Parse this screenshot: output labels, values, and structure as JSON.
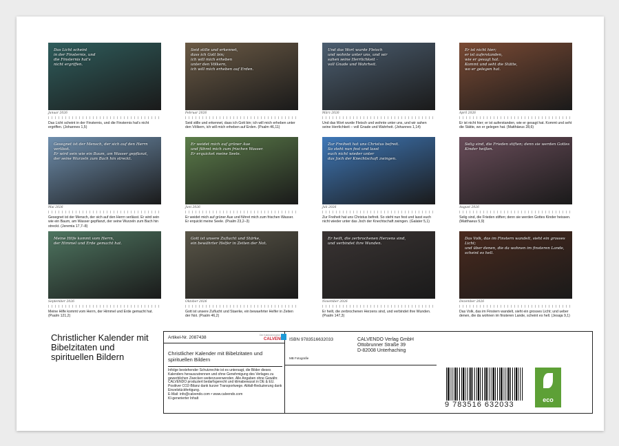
{
  "calendar": {
    "title": "Christlicher Kalender mit Bibelzitaten und spirituellen Bildern",
    "months": [
      {
        "label": "Januar 2026",
        "quote": "Das Licht scheint\nin der Finsternis, und\ndie Finsternis hat's\nnicht ergriffen.",
        "caption": "Das Licht scheint in der Finsternis, und die Finsternis hat's nicht ergriffen. (Johannes 1,5)",
        "bg": "#2f5d5c"
      },
      {
        "label": "Februar 2026",
        "quote": "Seid stille und erkennet,\ndass ich Gott bin;\nich will mich erheben\nunter den Völkern,\nich will mich erheben auf Erden.",
        "caption": "Seid stille und erkennet, dass ich Gott bin; ich will mich erheben unter den Völkern, ich will mich erheben auf Erden. (Psalm 46,11)",
        "bg": "#6b5a45"
      },
      {
        "label": "März 2026",
        "quote": "Und das Wort wurde Fleisch\nund wohnte unter uns, und wir\nsahen seine Herrlichkeit –\nvoll Gnade und Wahrheit.",
        "caption": "Und das Wort wurde Fleisch und wohnte unter uns, und wir sahen seine Herrlichkeit – voll Gnade und Wahrheit. (Johannes 1,14)",
        "bg": "#4c5e70"
      },
      {
        "label": "April 2026",
        "quote": "Er ist nicht hier;\ner ist auferstanden,\nwie er gesagt hat.\nKommt und seht die Stätte,\nwo er gelegen hat.",
        "caption": "Er ist nicht hier; er ist auferstanden, wie er gesagt hat. Kommt und seht die Stätte, wo er gelegen hat. (Matthäeus 28,6)",
        "bg": "#7a4a34"
      },
      {
        "label": "Mai 2026",
        "quote": "Gesegnet ist der Mensch, der sich auf den Herrn verlässt.\nEr wird sein wie ein Baum, am Wasser gepflanzt,\nder seine Wurzeln zum Bach hin streckt.",
        "caption": "Gesegnet ist der Mensch, der sich auf den Herrn verlässt. Er wird sein wie ein Baum, am Wasser gepflanzt, der seine Wurzeln zum Bach hin streckt. (Jeremia 17,7–8)",
        "bg": "#6f8fae"
      },
      {
        "label": "Juni 2026",
        "quote": "Er weidet mich auf grüner Aue\nund führet mich zum frischen Wasser.\nEr erquicket meine Seele.",
        "caption": "Er weidet mich auf grüner Aue und führet mich zum frischen Wasser. Er erquickt meine Seele. (Psalm 23,2–3)",
        "bg": "#5c7d4a"
      },
      {
        "label": "Juli 2026",
        "quote": "Zur Freiheit hat uns Christus befreit.\nSo steht nun fest und lasst\neuch nicht wieder unter\ndas Joch der Knechtschaft zwingen.",
        "caption": "Zur Freiheit hat uns Christus befreit. So steht nun fest und lasst euch nicht wieder unter das Joch der Knechtschaft zwingen. (Galater 5,1)",
        "bg": "#3f78b8"
      },
      {
        "label": "August 2026",
        "quote": "Selig sind, die Frieden stiften; denn sie werden Gottes Kinder heißen.",
        "caption": "Selig sind, die Frieden stiften; denn sie werden Gottes Kinder heissen. (Matthaeus 5,9)",
        "bg": "#6a4d5a"
      },
      {
        "label": "September 2026",
        "quote": "Meine Hilfe kommt vom Herrn,\nder Himmel und Erde gemacht hat.",
        "caption": "Meine Hilfe kommt vom Herrn, der Himmel und Erde gemacht hat. (Psalm 121,2)",
        "bg": "#4e7560"
      },
      {
        "label": "Oktober 2026",
        "quote": "Gott ist unsere Zuflucht und Stärke,\nein bewährter Helfer in Zeiten der Not.",
        "caption": "Gott ist unsere Zuflucht und Staerke, ein bewaehrter Helfer in Zeiten der Not. (Psalm 46,2)",
        "bg": "#5a5648"
      },
      {
        "label": "November 2026",
        "quote": "Er heilt, die zerbrochenen Herzens sind,\nund verbindet ihre Wunden.",
        "caption": "Er heilt, die zerbrochenen Herzens sind, und verbindet ihre Wunden. (Psalm 147,3)",
        "bg": "#3a3433"
      },
      {
        "label": "Dezember 2026",
        "quote": "Das Volk, das im Finstern wandelt, sieht ein grosses Licht;\nund über denen, die da wohnen im finsteren Lande,\nscheint es hell.",
        "caption": "Das Volk, das im Finstern wandelt, sieht ein grosses Licht; und ueber denen, die da wohnen im finsteren Lande, scheint es hell. (Jesaja 9,1)",
        "bg": "#4a2a1e"
      }
    ]
  },
  "info": {
    "article": "Artikel-Nr. 2087438",
    "logo": "CALVENDO",
    "logo_sub": "Die Kalendermarke",
    "subtitle": "Christlicher Kalender mit Bibelzitaten und spirituellen Bildern",
    "legal": "Infolge bestehender Schutzrechte ist es untersagt, die Bilder dieses Kalenders herauszutrennen und ohne Genehmigung des Verlages zu gewerblichen Zwecken weiterzuverwenden. Alle Angaben ohne Gewähr.\nCALVENDO produziert bedarfsgerecht und klimabewusst in DE & EU. Positiver CO2-Bilanz dank kurzer Transportwege. Abfall-Reduzierung dank Einzelstückfertigung.\nE-Mail: info@calvendo.com • www.calvendo.com\nKI-generierter Inhalt",
    "isbn": "ISBN 9783516632033",
    "photographer": "MB Fotografie",
    "publisher": [
      "CALVENDO Verlag GmbH",
      "Ottobrunner Straße 39",
      "D-82008 Unterhaching"
    ],
    "barcode_number": "9 783516 632033",
    "eco_label": "eco"
  }
}
